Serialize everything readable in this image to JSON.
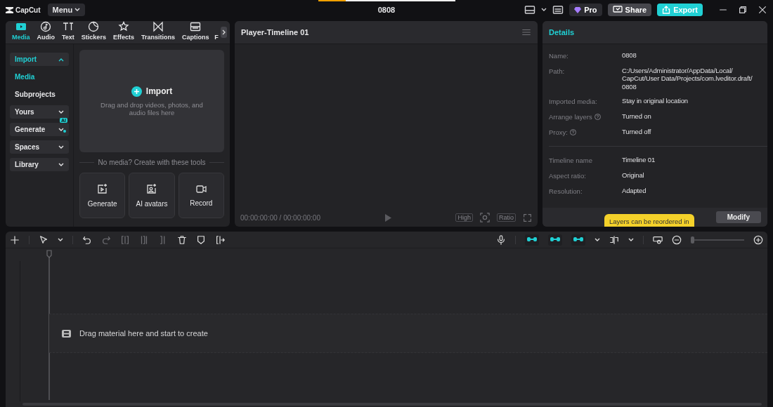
{
  "app": {
    "logo": "CapCut",
    "menu": "Menu",
    "title": "0808",
    "loading": {
      "level": 0.2
    }
  },
  "header_buttons": [
    {
      "kind": "pro",
      "label": "Pro"
    },
    {
      "kind": "share",
      "label": "Share"
    },
    {
      "kind": "export",
      "label": "Export"
    }
  ],
  "tabs": [
    {
      "label": "Media",
      "selected": true
    },
    {
      "label": "Audio",
      "selected": false
    },
    {
      "label": "Text",
      "selected": false
    },
    {
      "label": "Stickers",
      "selected": false
    },
    {
      "label": "Effects",
      "selected": false
    },
    {
      "label": "Transitions",
      "selected": false
    },
    {
      "label": "Captions",
      "selected": false
    },
    {
      "label": "F",
      "selected": false
    }
  ],
  "sidebar": [
    {
      "label": "Import",
      "selected": true,
      "expanded": true,
      "children": [
        {
          "label": "Media",
          "selected": true
        },
        {
          "label": "Subprojects",
          "selected": false
        }
      ]
    },
    {
      "label": "Yours",
      "selected": false,
      "expanded": false
    },
    {
      "label": "Generate",
      "selected": false,
      "expanded": false,
      "badge": "AI"
    },
    {
      "label": "Spaces",
      "selected": false,
      "expanded": false
    },
    {
      "label": "Library",
      "selected": false,
      "expanded": false
    }
  ],
  "import_area": {
    "title": "Import",
    "hint": "Drag and drop videos, photos, and audio files here"
  },
  "tools_caption": "No media? Create with these tools",
  "tools": [
    "Generate",
    "AI avatars",
    "Record"
  ],
  "player": {
    "title": "Player-Timeline 01",
    "timecode": "00:00:00:00 / 00:00:00:00",
    "quality": "High",
    "ratio": "Ratio"
  },
  "details": {
    "title": "Details",
    "groups": [
      [
        {
          "label": "Name:",
          "value": "0808",
          "help": false
        },
        {
          "label": "Path:",
          "value": "C:/Users/Administrator/AppData/Local/\nCapCut/User Data/Projects/com.lveditor.draft/\n0808",
          "help": false
        },
        {
          "label": "Imported media:",
          "value": "Stay in original location",
          "help": false
        },
        {
          "label": "Arrange layers",
          "value": "Turned on",
          "help": true
        },
        {
          "label": "Proxy:",
          "value": "Turned off",
          "help": true
        }
      ],
      [
        {
          "label": "Timeline name",
          "value": "Timeline 01",
          "help": false
        },
        {
          "label": "Aspect ratio:",
          "value": "Original",
          "help": false
        },
        {
          "label": "Resolution:",
          "value": "Adapted",
          "help": false
        }
      ]
    ],
    "button": "Modify"
  },
  "tooltip": "Layers can be reordered in",
  "timeline": {
    "toggles": [
      {
        "on": true
      },
      {
        "on": true
      },
      {
        "on": true
      }
    ],
    "zoom": {
      "level": 0
    },
    "hint": "Drag material here and start to create"
  }
}
